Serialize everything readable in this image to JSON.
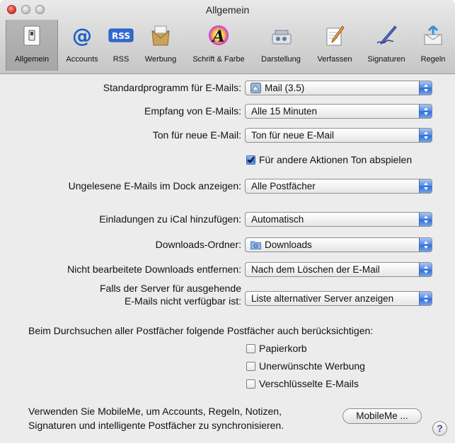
{
  "window": {
    "title": "Allgemein"
  },
  "toolbar": [
    {
      "label": "Allgemein",
      "icon": "light-switch-icon"
    },
    {
      "label": "Accounts",
      "icon": "at-sign-icon"
    },
    {
      "label": "RSS",
      "icon": "rss-icon",
      "badge": "RSS"
    },
    {
      "label": "Werbung",
      "icon": "junk-mail-icon"
    },
    {
      "label": "Schrift & Farbe",
      "icon": "font-color-icon",
      "glyph": "A"
    },
    {
      "label": "Darstellung",
      "icon": "viewing-icon"
    },
    {
      "label": "Verfassen",
      "icon": "compose-icon"
    },
    {
      "label": "Signaturen",
      "icon": "signature-icon"
    },
    {
      "label": "Regeln",
      "icon": "rules-icon"
    }
  ],
  "form": {
    "default_client": {
      "label": "Standardprogramm für E-Mails:",
      "value": "Mail (3.5)"
    },
    "check_mail": {
      "label": "Empfang von E-Mails:",
      "value": "Alle 15 Minuten"
    },
    "sound": {
      "label": "Ton für neue E-Mail:",
      "value": "Ton für neue E-Mail"
    },
    "play_sounds": {
      "label": "Für andere Aktionen Ton abspielen",
      "checked": true
    },
    "dock_unread": {
      "label": "Ungelesene E-Mails im Dock anzeigen:",
      "value": "Alle Postfächer"
    },
    "ical": {
      "label": "Einladungen zu iCal hinzufügen:",
      "value": "Automatisch"
    },
    "downloads_folder": {
      "label": "Downloads-Ordner:",
      "value": "Downloads"
    },
    "remove_downloads": {
      "label": "Nicht bearbeitete Downloads entfernen:",
      "value": "Nach dem Löschen der E-Mail"
    },
    "server_unavailable": {
      "label_line1": "Falls der Server für ausgehende",
      "label_line2": "E-Mails nicht verfügbar ist:",
      "value": "Liste alternativer Server anzeigen"
    },
    "search_heading": "Beim Durchsuchen aller Postfächer folgende Postfächer auch berücksichtigen:",
    "search_boxes": [
      {
        "label": "Papierkorb",
        "checked": false
      },
      {
        "label": "Unerwünschte Werbung",
        "checked": false
      },
      {
        "label": "Verschlüsselte E-Mails",
        "checked": false
      }
    ],
    "mobileme_line1": "Verwenden Sie MobileMe, um Accounts, Regeln, Notizen,",
    "mobileme_line2": "Signaturen und intelligente Postfächer zu synchronisieren.",
    "mobileme_button": "MobileMe ...",
    "help": "?"
  },
  "colors": {
    "accent_blue": "#2f6bd6",
    "toolbar_selected": "#a6a6a6",
    "window_bg": "#ececec"
  }
}
